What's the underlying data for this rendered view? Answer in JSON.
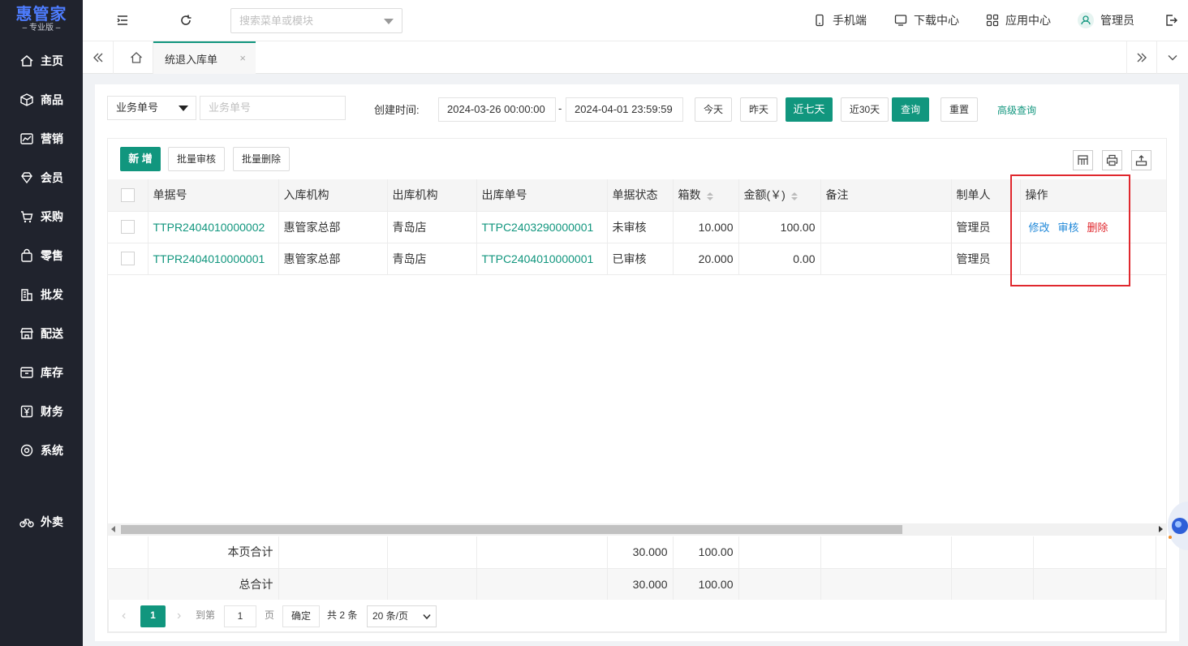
{
  "app": {
    "logo_title": "惠管家",
    "logo_subtitle": "– 专业版 –"
  },
  "sidebar": {
    "items": [
      {
        "label": "主页",
        "icon": "home-icon"
      },
      {
        "label": "商品",
        "icon": "box-icon"
      },
      {
        "label": "营销",
        "icon": "chart-icon"
      },
      {
        "label": "会员",
        "icon": "diamond-icon"
      },
      {
        "label": "采购",
        "icon": "cart-icon"
      },
      {
        "label": "零售",
        "icon": "bag-icon"
      },
      {
        "label": "批发",
        "icon": "building-icon"
      },
      {
        "label": "配送",
        "icon": "store-icon"
      },
      {
        "label": "库存",
        "icon": "inbox-icon"
      },
      {
        "label": "财务",
        "icon": "yen-icon"
      },
      {
        "label": "系统",
        "icon": "settings-icon"
      },
      {
        "label": "外卖",
        "icon": "bike-icon"
      }
    ]
  },
  "topbar": {
    "search_placeholder": "搜索菜单或模块",
    "mobile": "手机端",
    "download": "下载中心",
    "apps": "应用中心",
    "user": "管理员"
  },
  "tabs": {
    "active": "统退入库单",
    "close": "×"
  },
  "filter": {
    "type_select": "业务单号",
    "order_placeholder": "业务单号",
    "created_label": "创建时间:",
    "date_start": "2024-03-26 00:00:00",
    "date_sep": "-",
    "date_end": "2024-04-01 23:59:59",
    "today": "今天",
    "yesterday": "昨天",
    "last7": "近七天",
    "last30": "近30天",
    "query": "查询",
    "reset": "重置",
    "advanced": "高级查询"
  },
  "toolbar": {
    "add": "新 增",
    "batch_audit": "批量审核",
    "batch_delete": "批量删除"
  },
  "table": {
    "headers": [
      "单据号",
      "入库机构",
      "出库机构",
      "出库单号",
      "单据状态",
      "箱数",
      "金额(￥)",
      "备注",
      "制单人",
      "操作"
    ],
    "rows": [
      {
        "doc_no": "TTPR2404010000002",
        "in_org": "惠管家总部",
        "out_org": "青岛店",
        "out_no": "TTPC2403290000001",
        "status": "未审核",
        "boxes": "10.000",
        "amount": "100.00",
        "remark": "",
        "maker": "管理员",
        "ops": [
          "修改",
          "审核",
          "删除"
        ]
      },
      {
        "doc_no": "TTPR2404010000001",
        "in_org": "惠管家总部",
        "out_org": "青岛店",
        "out_no": "TTPC2404010000001",
        "status": "已审核",
        "boxes": "20.000",
        "amount": "0.00",
        "remark": "",
        "maker": "管理员",
        "ops": []
      }
    ],
    "page_total": {
      "label": "本页合计",
      "boxes": "30.000",
      "amount": "100.00"
    },
    "grand_total": {
      "label": "总合计",
      "boxes": "30.000",
      "amount": "100.00"
    }
  },
  "pagination": {
    "current": "1",
    "goto_label": "到第",
    "goto_value": "1",
    "page_unit": "页",
    "confirm": "确定",
    "total": "共 2 条",
    "page_size": "20 条/页"
  },
  "colors": {
    "accent": "#11967e",
    "link_blue": "#1e87d8",
    "danger": "#e0282e",
    "sidebar_bg": "#20232d"
  }
}
